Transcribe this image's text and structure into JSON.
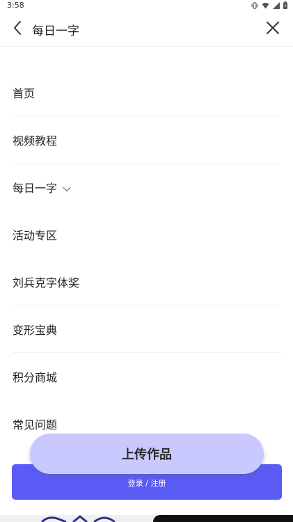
{
  "status_bar": {
    "time": "3:58",
    "icons": [
      "vibrate-icon",
      "wifi-icon",
      "signal-icon",
      "battery-icon"
    ]
  },
  "header": {
    "title": "每日一字",
    "back_icon": "chevron-left-icon",
    "close_icon": "close-icon"
  },
  "menu": {
    "items": [
      {
        "label": "首页"
      },
      {
        "label": "视频教程"
      },
      {
        "label": "每日一字",
        "expand_icon": "chevron-down-icon"
      },
      {
        "label": "活动专区"
      },
      {
        "label": "刘兵克字体奖"
      },
      {
        "label": "变形宝典"
      },
      {
        "label": "积分商城"
      },
      {
        "label": "常见问题"
      }
    ]
  },
  "upload_button": {
    "label": "上传作品"
  },
  "login_button": {
    "label": "登录 / 注册"
  },
  "colors": {
    "accent": "#5b5bf6",
    "upload_bg": "#c9c9ff"
  }
}
